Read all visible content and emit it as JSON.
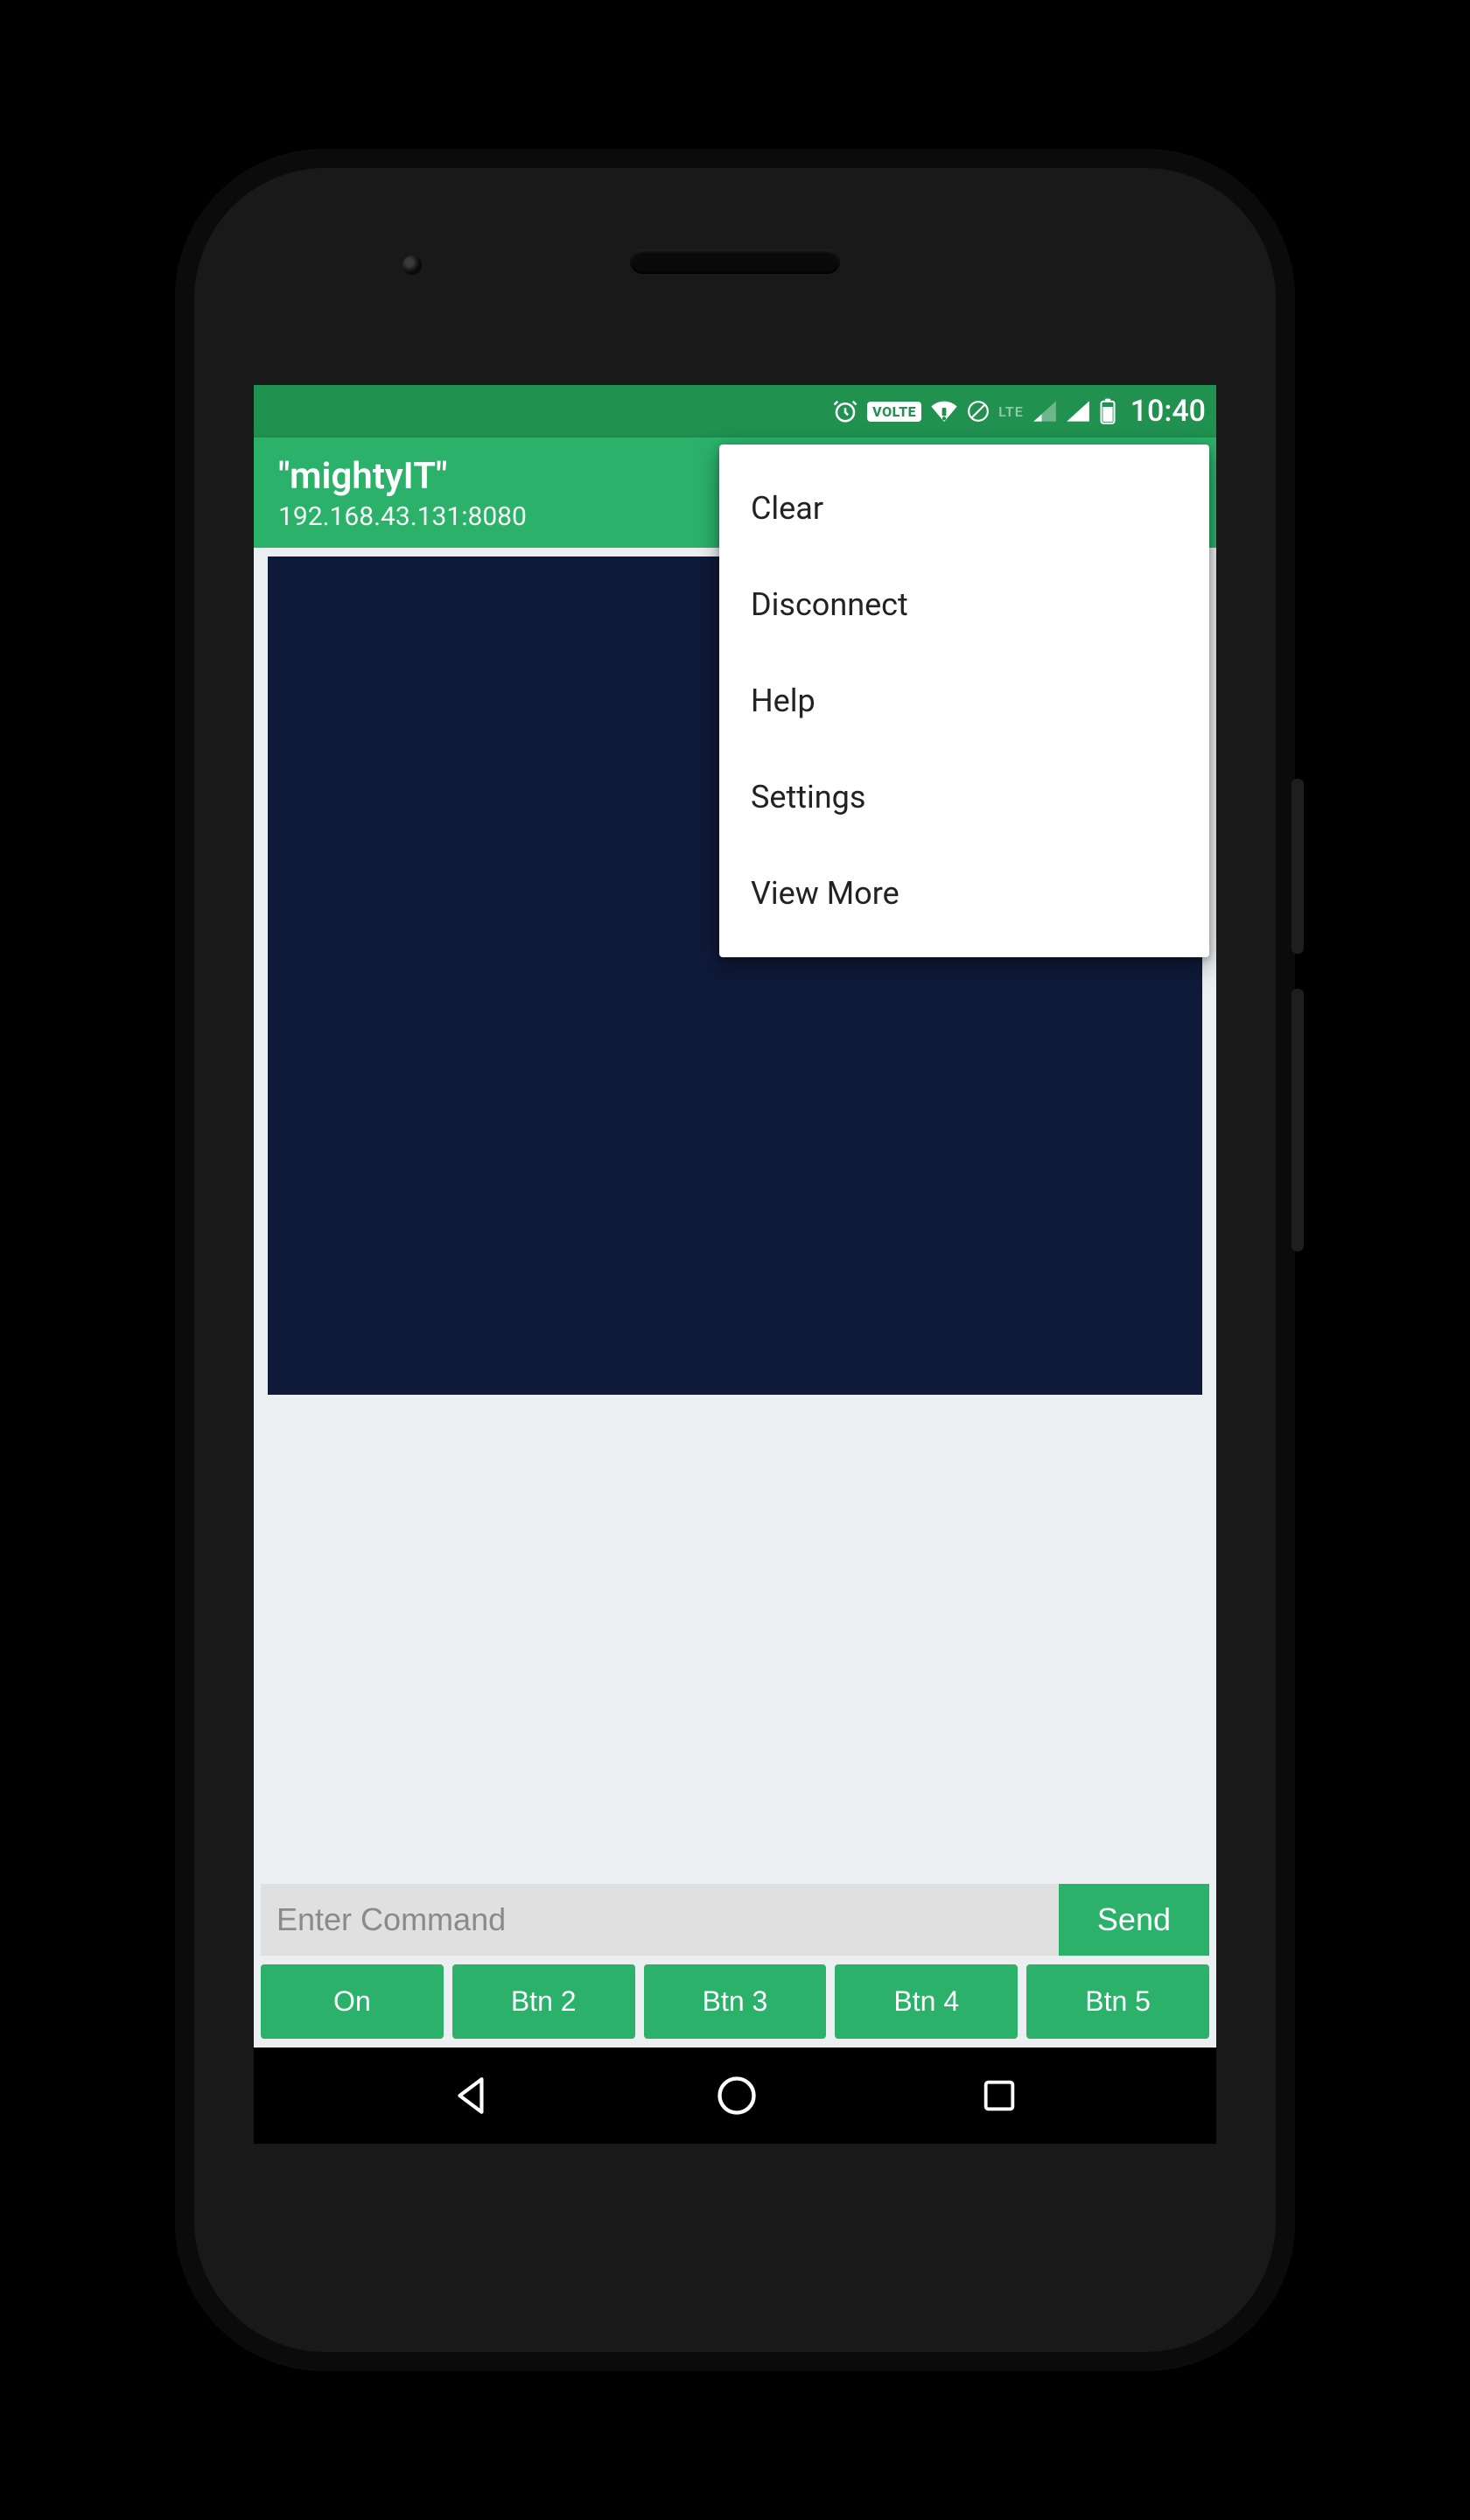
{
  "status_bar": {
    "time": "10:40",
    "lte": "LTE",
    "volte": "VOLTE"
  },
  "app_bar": {
    "title": "\"mightyIT\"",
    "subtitle": "192.168.43.131:8080"
  },
  "menu": {
    "items": [
      {
        "label": "Clear"
      },
      {
        "label": "Disconnect"
      },
      {
        "label": "Help"
      },
      {
        "label": "Settings"
      },
      {
        "label": "View More"
      }
    ]
  },
  "command": {
    "placeholder": "Enter Command",
    "send_label": "Send"
  },
  "buttons": [
    {
      "label": "On"
    },
    {
      "label": "Btn 2"
    },
    {
      "label": "Btn 3"
    },
    {
      "label": "Btn 4"
    },
    {
      "label": "Btn 5"
    }
  ],
  "colors": {
    "accent": "#2bb16a",
    "status": "#219150",
    "terminal": "#0f1a39"
  }
}
